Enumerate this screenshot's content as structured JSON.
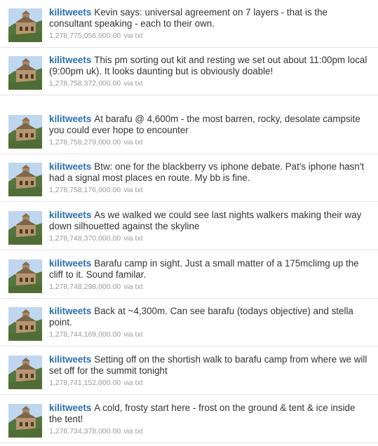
{
  "timeline": {
    "tweets": [
      {
        "user": "kilitweets",
        "text": "Kevin says: universal agreement on 7 layers - that is the consultant speaking - each to their own.",
        "timestamp": "1,278,775,056,000.00",
        "via": "via txt"
      },
      {
        "user": "kilitweets",
        "text": "This pm sorting out kit and resting we set out about 11:00pm local (9:00pm uk). It looks daunting but is obviously doable!",
        "timestamp": "1,278,758,372,000.00",
        "via": "via txt"
      },
      {
        "user": "kilitweets",
        "text": "At barafu @ 4,600m - the most barren, rocky, desolate campsite you could ever hope to encounter",
        "timestamp": "1,278,758,279,000.00",
        "via": "via txt"
      },
      {
        "user": "kilitweets",
        "text": "Btw: one for the blackberry vs iphone debate. Pat's iphone hasn't had a signal most places en route. My bb is fine.",
        "timestamp": "1,278,758,176,000.00",
        "via": "via txt"
      },
      {
        "user": "kilitweets",
        "text": "As we walked we could see last nights walkers making their way down silhouetted against the skyline",
        "timestamp": "1,278,748,370,000.00",
        "via": "via txt"
      },
      {
        "user": "kilitweets",
        "text": "Barafu camp in sight. Just a small matter of a 175mclimg up the cliff to it. Sound familar.",
        "timestamp": "1,278,748,298,000.00",
        "via": "via txt"
      },
      {
        "user": "kilitweets",
        "text": "Back at ~4,300m. Can see barafu (todays objective) and stella point.",
        "timestamp": "1,278,744,169,000.00",
        "via": "via txt"
      },
      {
        "user": "kilitweets",
        "text": "Setting off on the shortish walk to barafu camp from where we will set off for the summit tonight",
        "timestamp": "1,278,741,152,000.00",
        "via": "via txt"
      },
      {
        "user": "kilitweets",
        "text": "A cold, frosty start here - frost on the ground & tent & ice inside the tent!",
        "timestamp": "1,278,734,378,000.00",
        "via": "via txt"
      }
    ]
  }
}
